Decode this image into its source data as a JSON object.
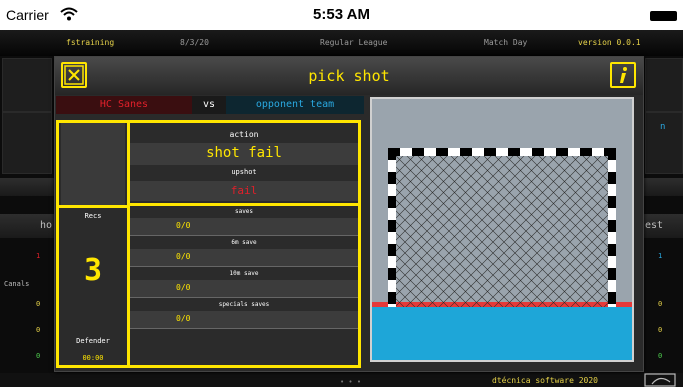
{
  "statusbar": {
    "carrier": "Carrier",
    "time": "5:53 AM"
  },
  "infobar": {
    "training": "fstraining",
    "date": "8/3/20",
    "league": "Regular League",
    "match_day": "Match Day",
    "version": "version 0.0.1"
  },
  "background": {
    "left_label": "ho",
    "right_label": "est",
    "canals": "Canals",
    "right_side_value": "n",
    "left_nums": [
      "0",
      "0",
      "0"
    ],
    "right_nums": [
      "0",
      "0",
      "0"
    ],
    "red_num": "1",
    "blue_num": "1",
    "footer": "dtécnica software 2020",
    "footer_mid": "• • •"
  },
  "modal": {
    "title": "pick shot",
    "home_team": "HC Sanes",
    "vs": "vs",
    "opponent": "opponent team",
    "player": {
      "role": "Recs",
      "number": "3",
      "position": "Defender",
      "time": "00:00"
    },
    "action_label": "action",
    "action_value": "shot fail",
    "upshot_label": "upshot",
    "upshot_value": "fail",
    "stats": [
      {
        "label": "saves",
        "value": "0/0"
      },
      {
        "label": "6m save",
        "value": "0/0"
      },
      {
        "label": "10m save",
        "value": "0/0"
      },
      {
        "label": "specials saves",
        "value": "0/0"
      }
    ]
  },
  "colors": {
    "accent": "#ffe600",
    "home": "#e0202a",
    "opponent": "#2aa8e0",
    "court": "#1ea6d8"
  }
}
